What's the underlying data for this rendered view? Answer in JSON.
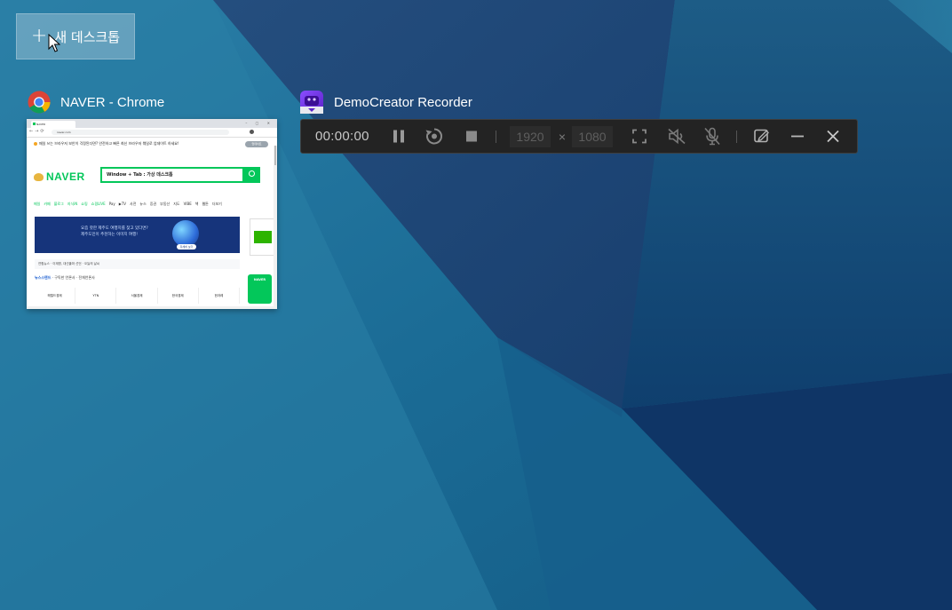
{
  "desktop": {
    "new_desktop_label": "새 데스크톱",
    "colors": {
      "background": "#1a6a93",
      "accent": "#03c75a"
    }
  },
  "windows": [
    {
      "title": "NAVER - Chrome",
      "icon": "chrome-icon",
      "thumbnail": {
        "tab_title": "NAVER",
        "url": "naver.com",
        "notice": "매일 쓰는 브라우저 보안이 걱정된다면? 안전하고 빠른 최신 브라우저 웨일로 업데이트 하세요!",
        "update_label": "업데이트",
        "logo": "NAVER",
        "search_text": "Window + Tab : 가상 데스크톱",
        "menu": [
          "메일",
          "카페",
          "블로그",
          "지식iN",
          "쇼핑",
          "쇼핑LIVE",
          "Pay",
          "▶TV",
          "사전",
          "뉴스",
          "증권",
          "부동산",
          "지도",
          "VIBE",
          "책",
          "웹툰",
          "더보기"
        ],
        "banner_lines": [
          "요즘 핫한 제주도 여행지를 찾고 있다면?",
          "제주도민이 추천하는 이미지 여행!"
        ],
        "banner_button": "자세히 보기",
        "weather": "연합뉴스 · 이재명, 대선출마 선언 · 오늘의 날씨",
        "news_label": "뉴스스탠드",
        "news_sub": "구독한 언론사 · 전체언론사",
        "news_outlets": [
          "헤럴드경제",
          "YTN",
          "서울경제",
          "한국경제",
          "한겨레"
        ],
        "side_card": "NAVER"
      }
    },
    {
      "title": "DemoCreator Recorder",
      "icon": "democreator-icon",
      "recorder": {
        "time": "00:00:00",
        "width": "1920",
        "height": "1080",
        "times_sign": "×"
      }
    }
  ]
}
